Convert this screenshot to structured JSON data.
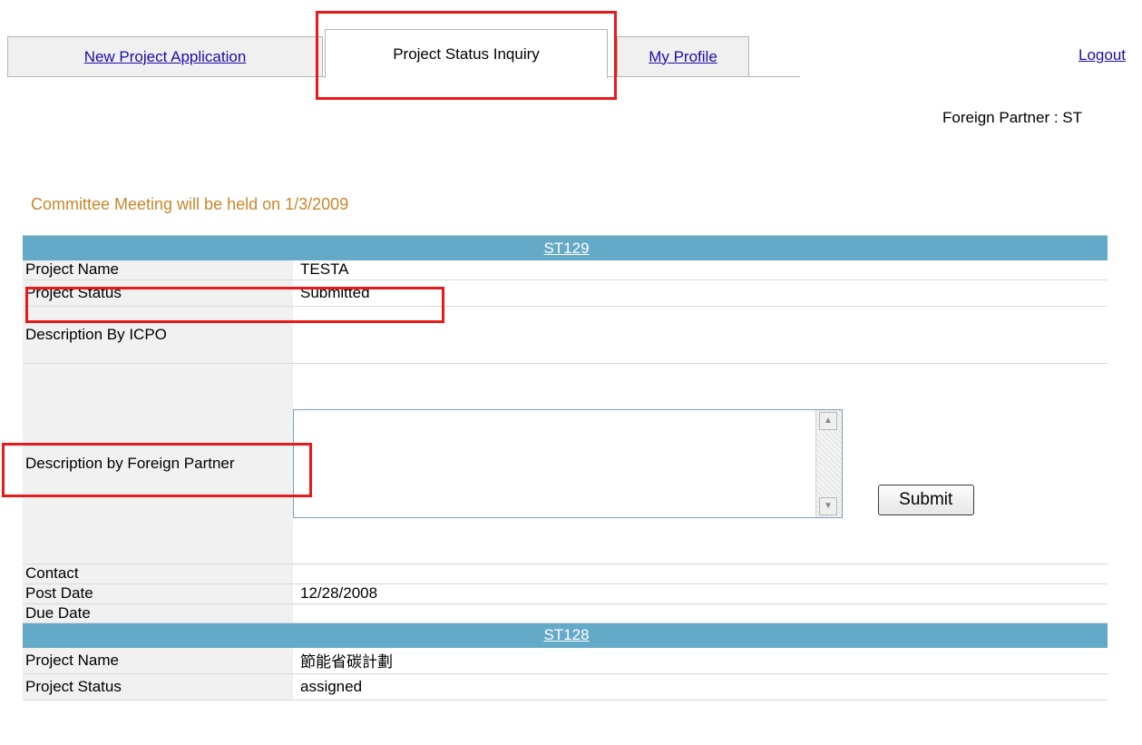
{
  "tabs": {
    "new_project": "New Project Application",
    "status_inquiry": "Project Status Inquiry",
    "my_profile": "My Profile"
  },
  "header": {
    "logout": "Logout",
    "partner": "Foreign Partner : ST"
  },
  "notice": "Committee Meeting will be held on 1/3/2009",
  "labels": {
    "project_name": "Project Name",
    "project_status": "Project Status",
    "desc_icpo": "Description By ICPO",
    "desc_partner": "Description by Foreign Partner",
    "contact": "Contact",
    "post_date": "Post Date",
    "due_date": "Due Date"
  },
  "projects": [
    {
      "code": "ST129",
      "name": "TESTA",
      "status": "Submitted",
      "desc_icpo": "",
      "desc_partner": "",
      "contact": "",
      "post_date": "12/28/2008",
      "due_date": ""
    },
    {
      "code": "ST128",
      "name": "節能省碳計劃",
      "status": "assigned"
    }
  ],
  "submit_label": "Submit",
  "colors": {
    "header_row": "#65a9c8",
    "highlight": "#e8191b",
    "notice": "#c8872a",
    "link": "#1a0ea8"
  }
}
